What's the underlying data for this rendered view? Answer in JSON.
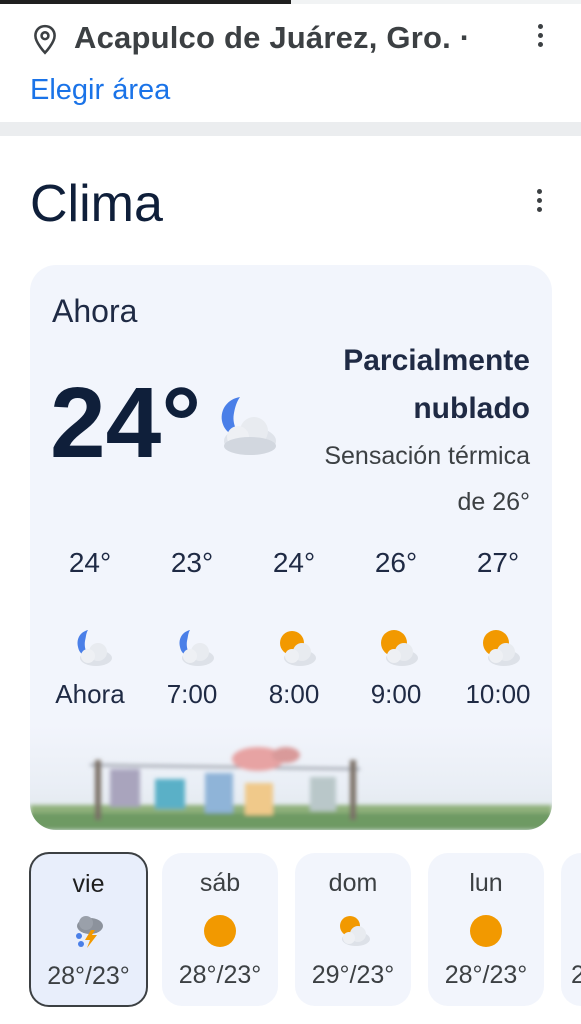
{
  "location": {
    "name": "Acapulco de Juárez, Gro. ·",
    "pin_icon": "location-pin-icon",
    "menu_icon": "more-vert-icon",
    "change_area_link": "Elegir área"
  },
  "weather": {
    "title": "Clima",
    "menu_icon": "more-vert-icon",
    "now_label": "Ahora",
    "temperature": "24°",
    "condition_line1": "Parcialmente",
    "condition_line2": "nublado",
    "feels_line1": "Sensación térmica",
    "feels_line2": "de 26°",
    "condition_icon": "partly-cloudy-night-icon",
    "hourly": [
      {
        "temp": "24°",
        "label": "Ahora",
        "icon": "partly-cloudy-night-icon"
      },
      {
        "temp": "23°",
        "label": "7:00",
        "icon": "partly-cloudy-night-icon"
      },
      {
        "temp": "24°",
        "label": "8:00",
        "icon": "partly-cloudy-day-icon"
      },
      {
        "temp": "26°",
        "label": "9:00",
        "icon": "partly-cloudy-day-icon"
      },
      {
        "temp": "27°",
        "label": "10:00",
        "icon": "partly-cloudy-day-icon"
      }
    ],
    "daily": [
      {
        "day": "vie",
        "range": "28°/23°",
        "icon": "thunderstorm-rain-icon",
        "selected": true
      },
      {
        "day": "sáb",
        "range": "28°/23°",
        "icon": "sunny-icon"
      },
      {
        "day": "dom",
        "range": "29°/23°",
        "icon": "partly-cloudy-day-icon"
      },
      {
        "day": "lun",
        "range": "28°/23°",
        "icon": "sunny-icon"
      },
      {
        "day": "",
        "range": "2",
        "icon": ""
      }
    ]
  },
  "colors": {
    "accent_link": "#1a73e8",
    "card_bg": "#f2f5fc",
    "moon_blue": "#4a7fe8",
    "sun_orange": "#f29900"
  }
}
